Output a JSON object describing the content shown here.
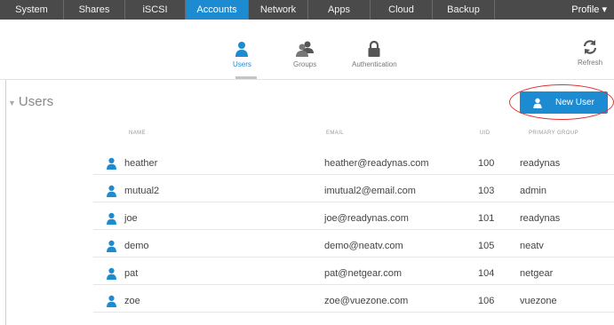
{
  "topnav": {
    "tabs": [
      {
        "label": "System"
      },
      {
        "label": "Shares"
      },
      {
        "label": "iSCSI"
      },
      {
        "label": "Accounts"
      },
      {
        "label": "Network"
      },
      {
        "label": "Apps"
      },
      {
        "label": "Cloud"
      },
      {
        "label": "Backup"
      }
    ],
    "profile_label": "Profile ▾",
    "active_tab": "Accounts",
    "colors": {
      "bar": "#4a4a4a",
      "active": "#1d8bd1"
    }
  },
  "subnav": {
    "items": [
      {
        "label": "Users",
        "icon": "user-icon"
      },
      {
        "label": "Groups",
        "icon": "group-icon"
      },
      {
        "label": "Authentication",
        "icon": "lock-icon"
      }
    ],
    "refresh_label": "Refresh",
    "refresh_icon": "refresh-icon"
  },
  "section": {
    "title": "Users",
    "new_user_label": "New User"
  },
  "table": {
    "columns": [
      "NAME",
      "EMAIL",
      "UID",
      "PRIMARY GROUP"
    ],
    "rows": [
      {
        "name": "heather",
        "email": "heather@readynas.com",
        "uid": "100",
        "group": "readynas"
      },
      {
        "name": "mutual2",
        "email": "imutual2@email.com",
        "uid": "103",
        "group": "admin"
      },
      {
        "name": "joe",
        "email": "joe@readynas.com",
        "uid": "101",
        "group": "readynas"
      },
      {
        "name": "demo",
        "email": "demo@neatv.com",
        "uid": "105",
        "group": "neatv"
      },
      {
        "name": "pat",
        "email": "pat@netgear.com",
        "uid": "104",
        "group": "netgear"
      },
      {
        "name": "zoe",
        "email": "zoe@vuezone.com",
        "uid": "106",
        "group": "vuezone"
      }
    ]
  }
}
